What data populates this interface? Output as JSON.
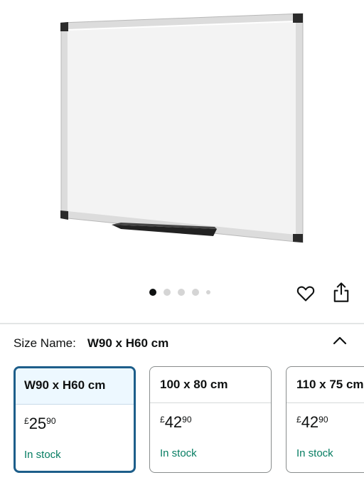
{
  "product_image": {
    "alt": "whiteboard-image"
  },
  "carousel": {
    "total_dots": 5,
    "active_index": 0
  },
  "actions": {
    "wishlist_icon": "heart-icon",
    "share_icon": "share-icon"
  },
  "size_selector": {
    "label": "Size Name:",
    "selected_value": "W90 x H60 cm",
    "collapse_icon": "chevron-up-icon",
    "options": [
      {
        "name": "W90 x H60 cm",
        "currency": "£",
        "price_whole": "25",
        "price_fraction": "90",
        "availability": "In stock"
      },
      {
        "name": "100 x 80 cm",
        "currency": "£",
        "price_whole": "42",
        "price_fraction": "90",
        "availability": "In stock"
      },
      {
        "name": "110 x 75 cm",
        "currency": "£",
        "price_whole": "42",
        "price_fraction": "90",
        "availability": "In stock"
      }
    ]
  },
  "colors": {
    "selected_border": "#1d5e8a",
    "in_stock": "#067d62",
    "active_dot": "#0f1111"
  }
}
